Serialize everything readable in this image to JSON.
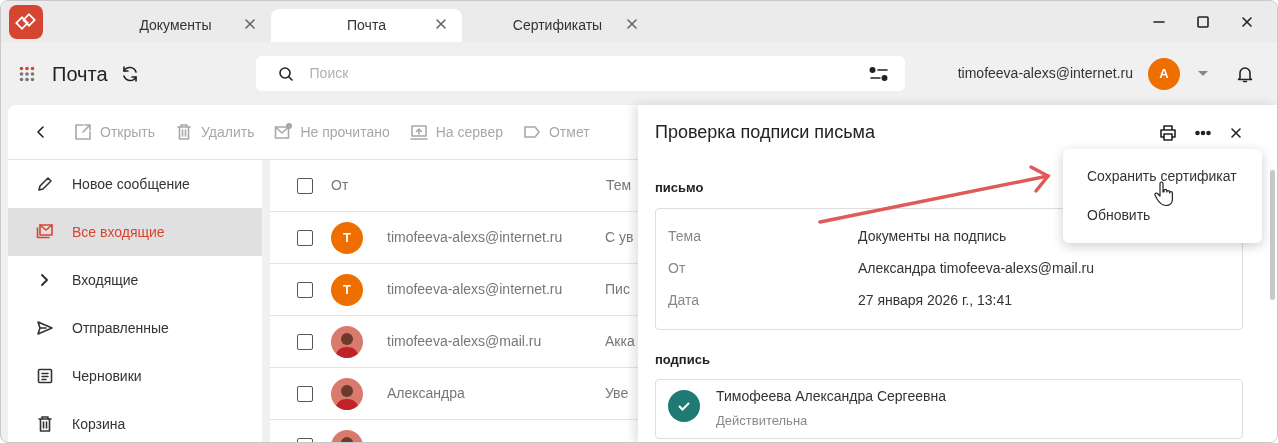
{
  "tabs": [
    {
      "label": "Документы",
      "selected": false
    },
    {
      "label": "Почта",
      "selected": true
    },
    {
      "label": "Сертификаты",
      "selected": false
    }
  ],
  "header": {
    "title": "Почта",
    "search": {
      "placeholder": "Поиск"
    },
    "account": "timofeeva-alexs@internet.ru",
    "avatar": "А"
  },
  "toolbar": [
    {
      "kind": "open",
      "label": "Открыть",
      "disabled": true
    },
    {
      "kind": "delete",
      "label": "Удалить",
      "disabled": true
    },
    {
      "kind": "unread",
      "label": "Не прочитано",
      "disabled": true
    },
    {
      "kind": "upload",
      "label": "На сервер",
      "disabled": true
    },
    {
      "kind": "tag",
      "label": "Отмет",
      "disabled": true
    }
  ],
  "sidebar": {
    "items": [
      {
        "kind": "compose",
        "label": "Новое сообщение",
        "selected": false
      },
      {
        "kind": "all",
        "label": "Все входящие",
        "selected": true
      },
      {
        "kind": "folder",
        "label": "Входящие",
        "selected": false
      },
      {
        "kind": "sent",
        "label": "Отправленные",
        "selected": false
      },
      {
        "kind": "drafts",
        "label": "Черновики",
        "selected": false
      },
      {
        "kind": "trash",
        "label": "Корзина",
        "selected": false
      }
    ]
  },
  "list": {
    "columns": [
      "От",
      "Тем"
    ],
    "select_all": false,
    "rows": [
      {
        "checked": false,
        "avatar": {
          "kind": "letter",
          "text": "Т"
        },
        "sender": "timofeeva-alexs@internet.ru",
        "subject": "С ув"
      },
      {
        "checked": false,
        "avatar": {
          "kind": "letter",
          "text": "Т"
        },
        "sender": "timofeeva-alexs@internet.ru",
        "subject": "Пис"
      },
      {
        "checked": false,
        "avatar": {
          "kind": "photo"
        },
        "sender": "timofeeva-alexs@mail.ru",
        "subject": "Акка"
      },
      {
        "checked": false,
        "avatar": {
          "kind": "photo"
        },
        "sender": "Александра",
        "subject": "Уве"
      },
      {
        "checked": false,
        "avatar": {
          "kind": "photo"
        }
      }
    ]
  },
  "panel": {
    "title": "Проверка подписи письма",
    "sections": [
      {
        "kind": "fields",
        "heading": "письмо",
        "fields": [
          {
            "label": "Тема",
            "value": "Документы на подпись"
          },
          {
            "label": "От",
            "value": "Александра timofeeva-alexs@mail.ru"
          },
          {
            "label": "Дата",
            "value": "27 января 2026 г., 13:41"
          }
        ]
      },
      {
        "kind": "signer",
        "heading": "подпись",
        "name": "Тимофеева Александра Сергеевна",
        "status": "Действительна",
        "valid": true
      }
    ]
  },
  "menu": {
    "items": [
      {
        "label": "Сохранить сертификат"
      },
      {
        "label": "Обновить"
      }
    ]
  }
}
